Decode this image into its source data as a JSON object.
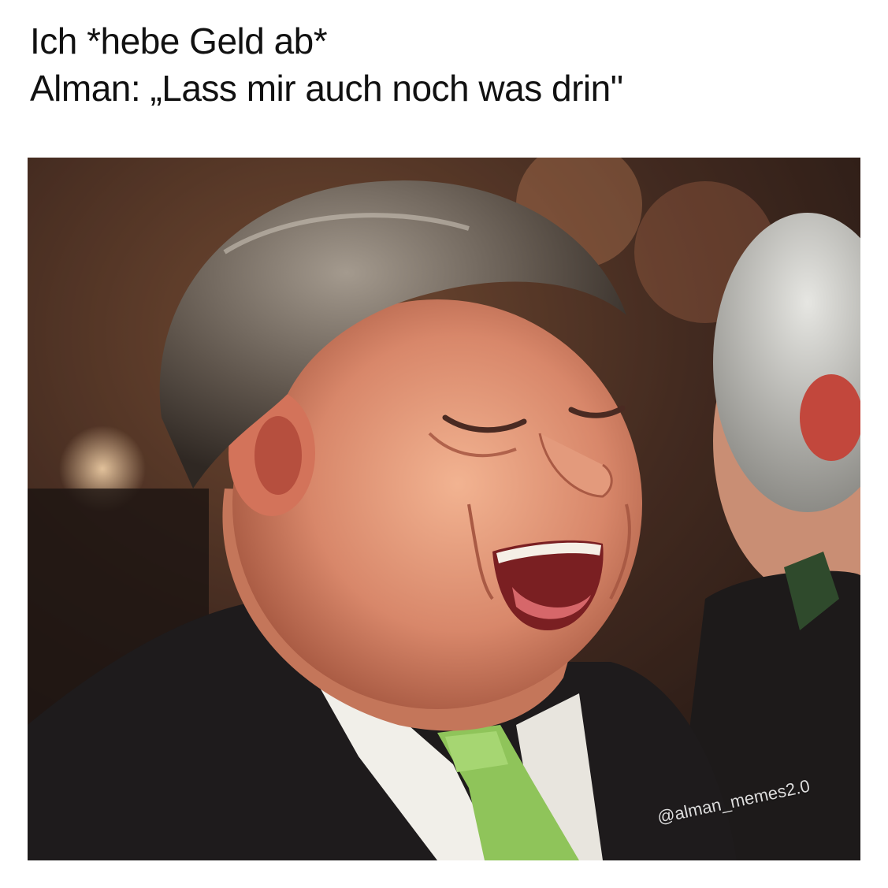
{
  "caption": {
    "line1": "Ich *hebe Geld ab*",
    "line2": "Alman: „Lass mir auch noch was drin\""
  },
  "photo": {
    "subject": "laughing-man-photo",
    "watermark": "@alman_memes2.0"
  },
  "colors": {
    "background": "#ffffff",
    "caption_text": "#111111",
    "tie": "#8fc45a",
    "suit": "#1e1b1c"
  }
}
